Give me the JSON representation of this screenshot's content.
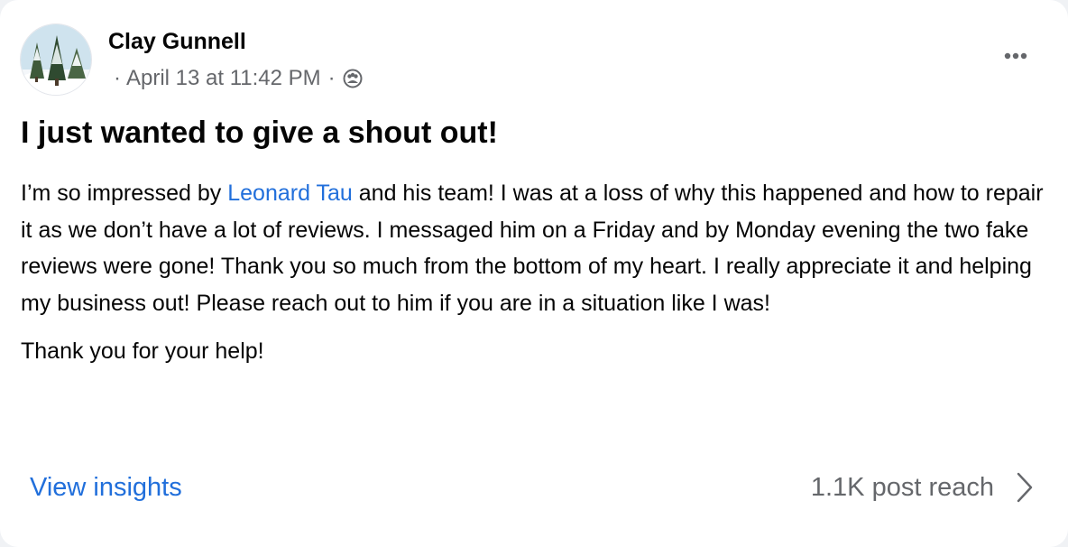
{
  "post": {
    "author": "Clay Gunnell",
    "bullet": "·",
    "timestamp": "April 13 at 11:42 PM",
    "separator": "·",
    "audience_icon": "group-audience-icon",
    "more_icon": "more-options-icon",
    "headline": "I just wanted to give a shout out!",
    "body": {
      "p1_before_mention": "I’m so impressed by ",
      "mention": "Leonard Tau",
      "p1_after_mention": " and his team! I was at a loss of why this happened and how to repair it as we don’t have a lot of reviews. I messaged him on a Friday and by Monday evening the two fake reviews were gone! Thank you so much from the bottom of my heart. I really appreciate it and helping my business out! Please reach out to him if you are in a situation like I was!",
      "p2": "Thank you for your help!"
    }
  },
  "footer": {
    "insights_link": "View insights",
    "reach": "1.1K post reach",
    "chevron_icon": "chevron-right-icon"
  },
  "colors": {
    "link": "#216fdb",
    "text": "#050505",
    "secondary": "#65676b",
    "background": "#ffffff"
  }
}
